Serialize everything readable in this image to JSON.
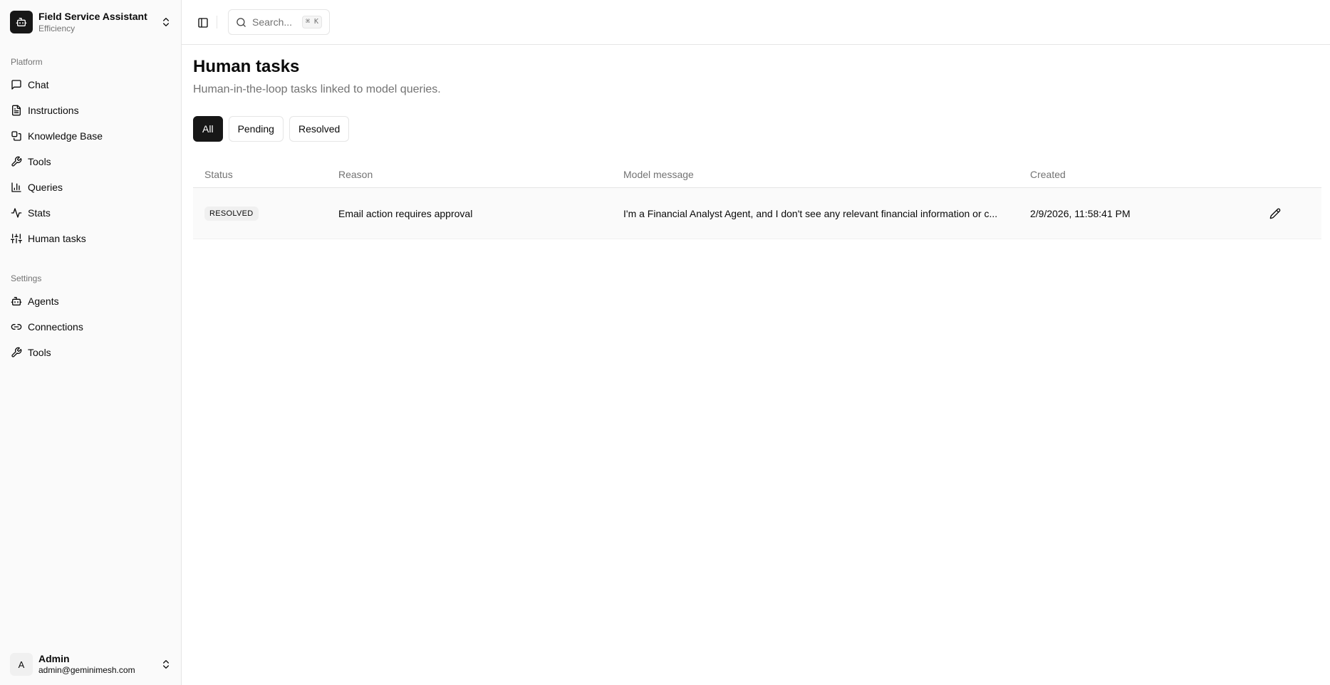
{
  "workspace": {
    "title": "Field Service Assistant",
    "subtitle": "Efficiency",
    "logo_icon": "bot-icon"
  },
  "sidebar": {
    "platform_label": "Platform",
    "platform_items": [
      {
        "label": "Chat",
        "icon": "message-square-icon"
      },
      {
        "label": "Instructions",
        "icon": "file-text-icon"
      },
      {
        "label": "Knowledge Base",
        "icon": "library-icon"
      },
      {
        "label": "Tools",
        "icon": "wrench-icon"
      },
      {
        "label": "Queries",
        "icon": "bar-chart-icon"
      },
      {
        "label": "Stats",
        "icon": "activity-icon"
      },
      {
        "label": "Human tasks",
        "icon": "sliders-icon"
      }
    ],
    "settings_label": "Settings",
    "settings_items": [
      {
        "label": "Agents",
        "icon": "bot-icon"
      },
      {
        "label": "Connections",
        "icon": "link-icon"
      },
      {
        "label": "Tools",
        "icon": "wrench-icon"
      }
    ]
  },
  "user": {
    "initial": "A",
    "name": "Admin",
    "email": "admin@geminimesh.com"
  },
  "header": {
    "search_placeholder": "Search...",
    "search_shortcut": "⌘ K"
  },
  "page": {
    "title": "Human tasks",
    "subtitle": "Human-in-the-loop tasks linked to model queries."
  },
  "filters": {
    "all": "All",
    "pending": "Pending",
    "resolved": "Resolved",
    "active": "all"
  },
  "table": {
    "columns": {
      "status": "Status",
      "reason": "Reason",
      "message": "Model message",
      "created": "Created"
    },
    "rows": [
      {
        "status": "RESOLVED",
        "reason": "Email action requires approval",
        "message": "I'm a Financial Analyst Agent, and I don't see any relevant financial information or c...",
        "created": "2/9/2026, 11:58:41 PM"
      }
    ]
  }
}
